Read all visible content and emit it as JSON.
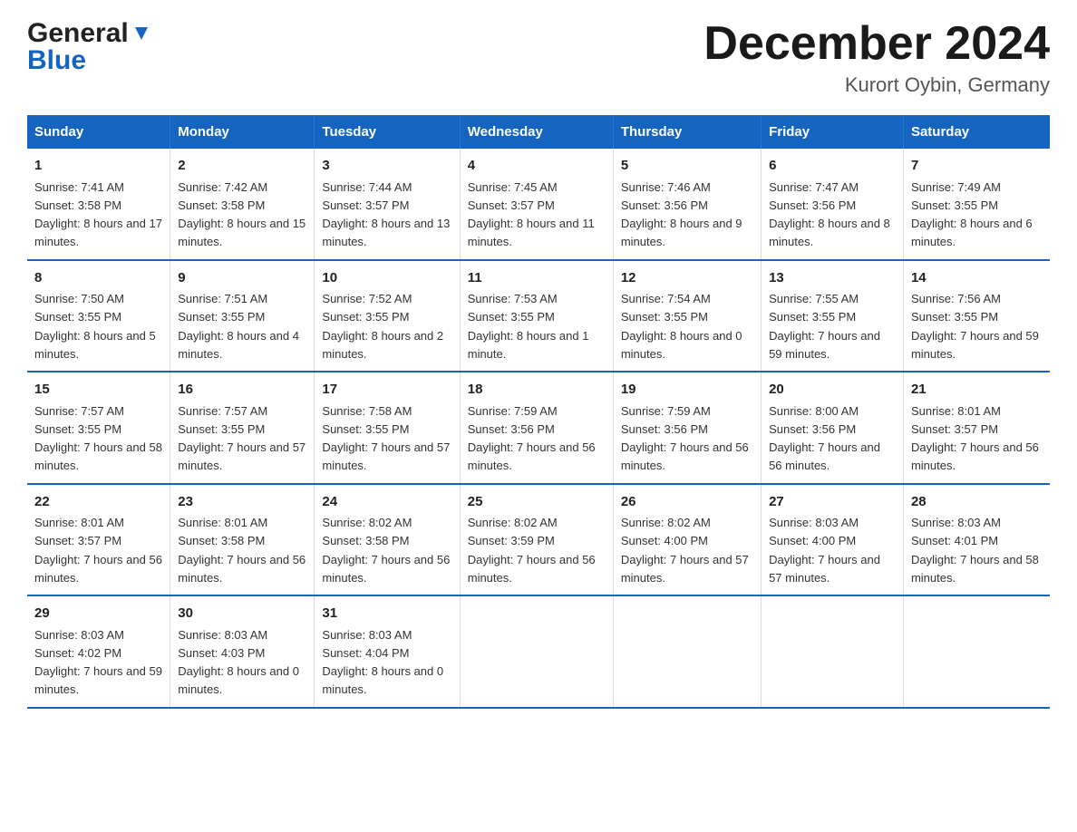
{
  "logo": {
    "general": "General",
    "blue": "Blue"
  },
  "title": "December 2024",
  "subtitle": "Kurort Oybin, Germany",
  "days_of_week": [
    "Sunday",
    "Monday",
    "Tuesday",
    "Wednesday",
    "Thursday",
    "Friday",
    "Saturday"
  ],
  "weeks": [
    [
      {
        "day": "1",
        "sunrise": "7:41 AM",
        "sunset": "3:58 PM",
        "daylight": "8 hours and 17 minutes."
      },
      {
        "day": "2",
        "sunrise": "7:42 AM",
        "sunset": "3:58 PM",
        "daylight": "8 hours and 15 minutes."
      },
      {
        "day": "3",
        "sunrise": "7:44 AM",
        "sunset": "3:57 PM",
        "daylight": "8 hours and 13 minutes."
      },
      {
        "day": "4",
        "sunrise": "7:45 AM",
        "sunset": "3:57 PM",
        "daylight": "8 hours and 11 minutes."
      },
      {
        "day": "5",
        "sunrise": "7:46 AM",
        "sunset": "3:56 PM",
        "daylight": "8 hours and 9 minutes."
      },
      {
        "day": "6",
        "sunrise": "7:47 AM",
        "sunset": "3:56 PM",
        "daylight": "8 hours and 8 minutes."
      },
      {
        "day": "7",
        "sunrise": "7:49 AM",
        "sunset": "3:55 PM",
        "daylight": "8 hours and 6 minutes."
      }
    ],
    [
      {
        "day": "8",
        "sunrise": "7:50 AM",
        "sunset": "3:55 PM",
        "daylight": "8 hours and 5 minutes."
      },
      {
        "day": "9",
        "sunrise": "7:51 AM",
        "sunset": "3:55 PM",
        "daylight": "8 hours and 4 minutes."
      },
      {
        "day": "10",
        "sunrise": "7:52 AM",
        "sunset": "3:55 PM",
        "daylight": "8 hours and 2 minutes."
      },
      {
        "day": "11",
        "sunrise": "7:53 AM",
        "sunset": "3:55 PM",
        "daylight": "8 hours and 1 minute."
      },
      {
        "day": "12",
        "sunrise": "7:54 AM",
        "sunset": "3:55 PM",
        "daylight": "8 hours and 0 minutes."
      },
      {
        "day": "13",
        "sunrise": "7:55 AM",
        "sunset": "3:55 PM",
        "daylight": "7 hours and 59 minutes."
      },
      {
        "day": "14",
        "sunrise": "7:56 AM",
        "sunset": "3:55 PM",
        "daylight": "7 hours and 59 minutes."
      }
    ],
    [
      {
        "day": "15",
        "sunrise": "7:57 AM",
        "sunset": "3:55 PM",
        "daylight": "7 hours and 58 minutes."
      },
      {
        "day": "16",
        "sunrise": "7:57 AM",
        "sunset": "3:55 PM",
        "daylight": "7 hours and 57 minutes."
      },
      {
        "day": "17",
        "sunrise": "7:58 AM",
        "sunset": "3:55 PM",
        "daylight": "7 hours and 57 minutes."
      },
      {
        "day": "18",
        "sunrise": "7:59 AM",
        "sunset": "3:56 PM",
        "daylight": "7 hours and 56 minutes."
      },
      {
        "day": "19",
        "sunrise": "7:59 AM",
        "sunset": "3:56 PM",
        "daylight": "7 hours and 56 minutes."
      },
      {
        "day": "20",
        "sunrise": "8:00 AM",
        "sunset": "3:56 PM",
        "daylight": "7 hours and 56 minutes."
      },
      {
        "day": "21",
        "sunrise": "8:01 AM",
        "sunset": "3:57 PM",
        "daylight": "7 hours and 56 minutes."
      }
    ],
    [
      {
        "day": "22",
        "sunrise": "8:01 AM",
        "sunset": "3:57 PM",
        "daylight": "7 hours and 56 minutes."
      },
      {
        "day": "23",
        "sunrise": "8:01 AM",
        "sunset": "3:58 PM",
        "daylight": "7 hours and 56 minutes."
      },
      {
        "day": "24",
        "sunrise": "8:02 AM",
        "sunset": "3:58 PM",
        "daylight": "7 hours and 56 minutes."
      },
      {
        "day": "25",
        "sunrise": "8:02 AM",
        "sunset": "3:59 PM",
        "daylight": "7 hours and 56 minutes."
      },
      {
        "day": "26",
        "sunrise": "8:02 AM",
        "sunset": "4:00 PM",
        "daylight": "7 hours and 57 minutes."
      },
      {
        "day": "27",
        "sunrise": "8:03 AM",
        "sunset": "4:00 PM",
        "daylight": "7 hours and 57 minutes."
      },
      {
        "day": "28",
        "sunrise": "8:03 AM",
        "sunset": "4:01 PM",
        "daylight": "7 hours and 58 minutes."
      }
    ],
    [
      {
        "day": "29",
        "sunrise": "8:03 AM",
        "sunset": "4:02 PM",
        "daylight": "7 hours and 59 minutes."
      },
      {
        "day": "30",
        "sunrise": "8:03 AM",
        "sunset": "4:03 PM",
        "daylight": "8 hours and 0 minutes."
      },
      {
        "day": "31",
        "sunrise": "8:03 AM",
        "sunset": "4:04 PM",
        "daylight": "8 hours and 0 minutes."
      },
      null,
      null,
      null,
      null
    ]
  ],
  "labels": {
    "sunrise": "Sunrise:",
    "sunset": "Sunset:",
    "daylight": "Daylight:"
  }
}
